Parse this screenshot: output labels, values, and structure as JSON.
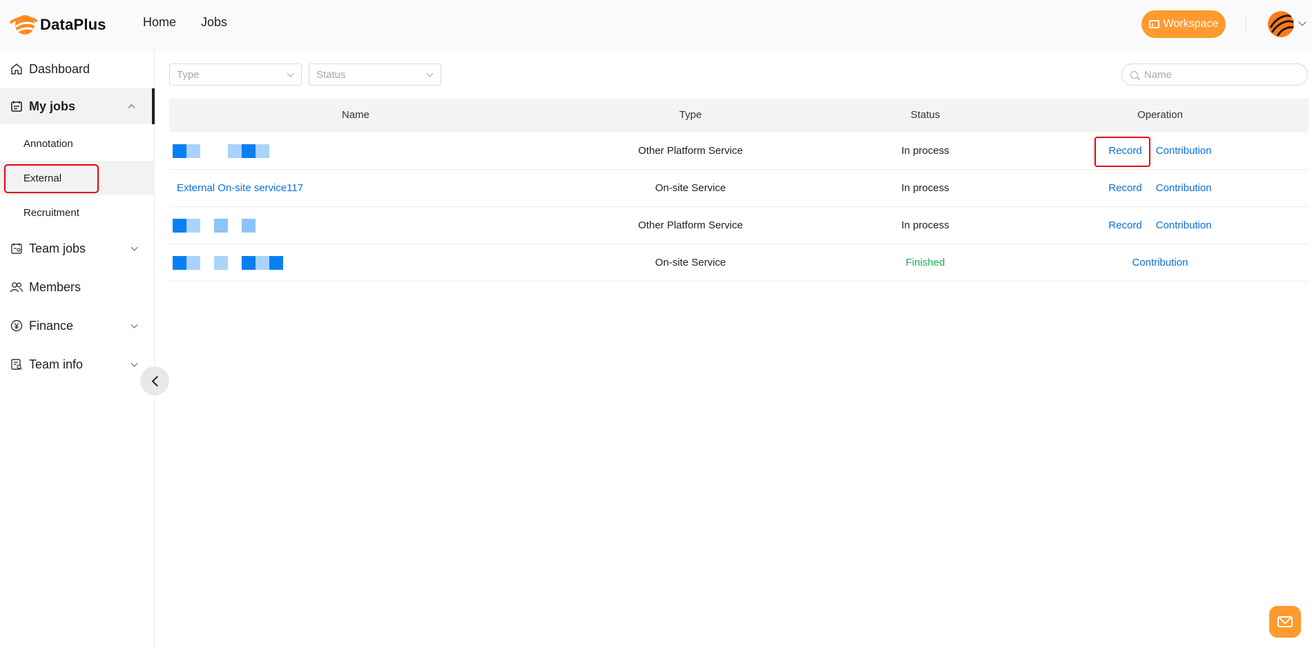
{
  "brand": {
    "name": "DataPlus"
  },
  "topnav": {
    "home": "Home",
    "jobs": "Jobs"
  },
  "header": {
    "workspace_label": "Workspace"
  },
  "sidebar": {
    "dashboard": "Dashboard",
    "my_jobs": "My jobs",
    "sub": {
      "annotation": "Annotation",
      "external": "External",
      "recruitment": "Recruitment"
    },
    "team_jobs": "Team jobs",
    "members": "Members",
    "finance": "Finance",
    "team_info": "Team info"
  },
  "filters": {
    "type_placeholder": "Type",
    "status_placeholder": "Status",
    "name_placeholder": "Name"
  },
  "table": {
    "columns": [
      "Name",
      "Type",
      "Status",
      "Operation"
    ],
    "rows": [
      {
        "name": "",
        "type": "Other Platform Service",
        "status": "In process",
        "record": "Record",
        "contribution": "Contribution"
      },
      {
        "name": "External On-site service117",
        "type": "On-site Service",
        "status": "In process",
        "record": "Record",
        "contribution": "Contribution"
      },
      {
        "name": "",
        "type": "Other Platform Service",
        "status": "In process",
        "record": "Record",
        "contribution": "Contribution"
      },
      {
        "name": "",
        "type": "On-site Service",
        "status": "Finished",
        "contribution": "Contribution"
      }
    ]
  },
  "colors": {
    "accent": "#ff9a2e",
    "link": "#0a6fd6",
    "finished": "#1aaf56",
    "highlight": "#e60012"
  },
  "icons": [
    "dashboard-icon",
    "my-jobs-icon",
    "team-jobs-icon",
    "members-icon",
    "finance-icon",
    "team-info-icon",
    "search-icon",
    "mail-icon"
  ]
}
